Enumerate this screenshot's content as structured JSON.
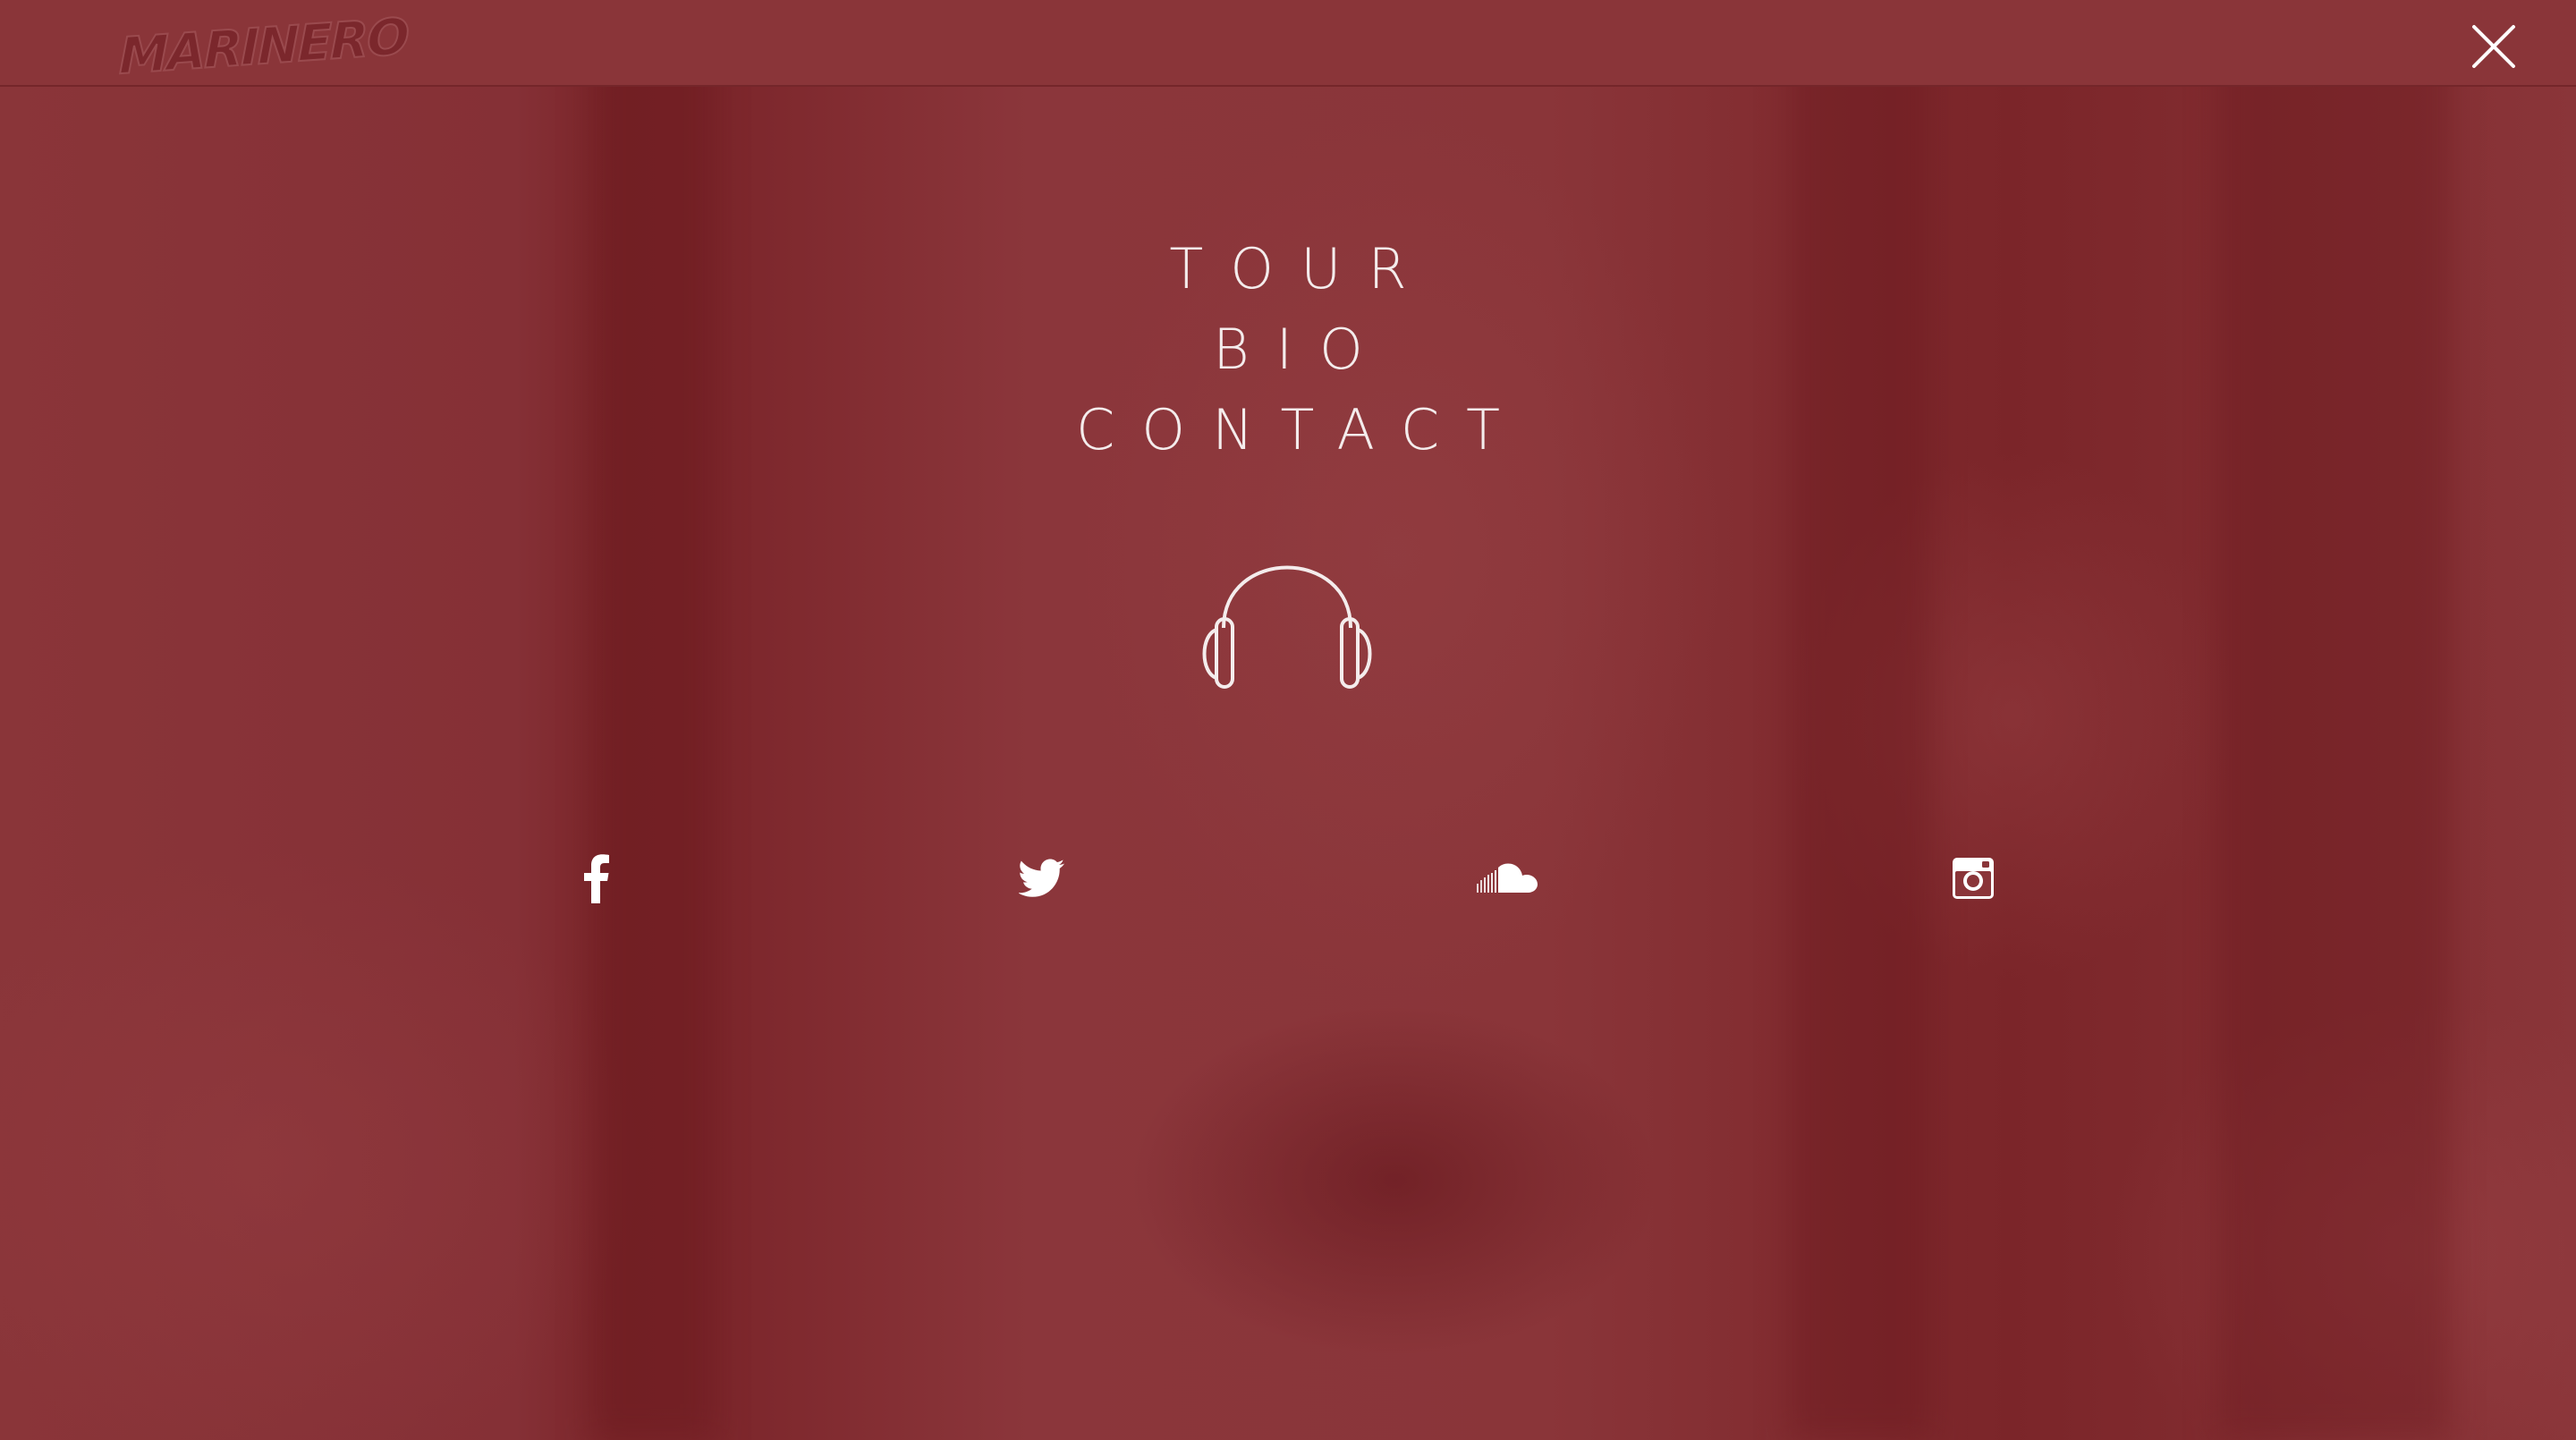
{
  "brand": {
    "logo_text": "MARINERO"
  },
  "menu": {
    "items": [
      {
        "label": "TOUR"
      },
      {
        "label": "BIO"
      },
      {
        "label": "CONTACT"
      }
    ]
  },
  "icons": {
    "close": "close-icon",
    "headphones": "headphones-icon",
    "social": [
      "facebook-icon",
      "twitter-icon",
      "soundcloud-icon",
      "instagram-icon"
    ]
  },
  "colors": {
    "overlay": "#8a3539",
    "text": "#f4ecec"
  }
}
